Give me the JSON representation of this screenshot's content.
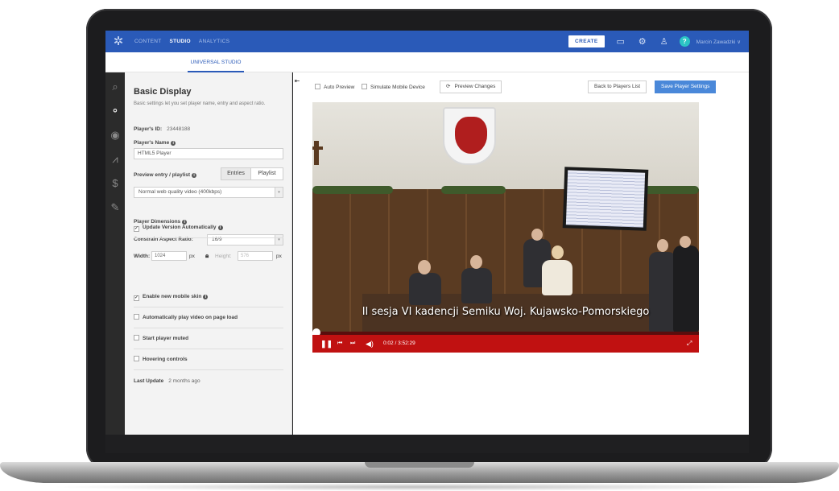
{
  "nav": {
    "items": [
      "CONTENT",
      "STUDIO",
      "ANALYTICS"
    ],
    "create_label": "CREATE",
    "user": "Marcin Zawadzki ∨"
  },
  "subnav": {
    "tab": "UNIVERSAL STUDIO"
  },
  "panel": {
    "title": "Basic Display",
    "description": "Basic settings let you set player name, entry and aspect ratio.",
    "player_id_label": "Player's ID:",
    "player_id": "23448188",
    "player_name_label": "Player's Name",
    "player_name": "HTML5 Player",
    "preview_label": "Preview entry / playlist",
    "seg_entries": "Entries",
    "seg_playlist": "Playlist",
    "entry_select": "Normal web quality video (400kbps)",
    "dimensions_label": "Player Dimensions",
    "aspect_label": "Constrain Aspect Ratio:",
    "aspect_value": "16/9",
    "width_label": "Width:",
    "width_value": "1024",
    "px": "px",
    "height_label": "Height:",
    "height_value": "576",
    "checks": [
      {
        "label": "Update Version Automatically",
        "checked": true,
        "info": true
      },
      {
        "label": "Enable new mobile skin",
        "checked": true,
        "info": true
      },
      {
        "label": "Automatically play video on page load",
        "checked": false,
        "info": false
      },
      {
        "label": "Start player muted",
        "checked": false,
        "info": false
      },
      {
        "label": "Hovering controls",
        "checked": false,
        "info": false
      }
    ],
    "last_update_label": "Last Update",
    "last_update": "2 months ago"
  },
  "toolbar": {
    "auto_preview": "Auto Preview",
    "simulate_mobile": "Simulate Mobile Device",
    "preview_changes": "Preview Changes",
    "back": "Back to Players List",
    "save": "Save Player Settings"
  },
  "player": {
    "subtitle": "II sesja VI kadencji Semiku Woj. Kujawsko-Pomorskiego",
    "time_current": "0:02",
    "time_total": "/ 3:52:29",
    "progress": 0.01
  },
  "colors": {
    "nav": "#2a5ab8",
    "accent": "#4a88d9",
    "player_bar": "#c01111"
  }
}
